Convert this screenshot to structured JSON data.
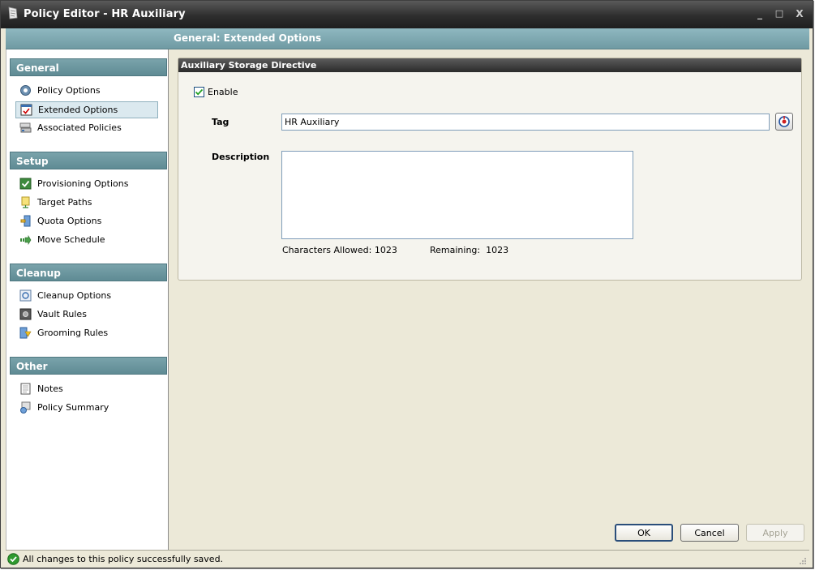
{
  "window": {
    "title": "Policy Editor - HR Auxiliary",
    "minimize": "_",
    "maximize": "□",
    "close": "X"
  },
  "header": {
    "title": "General: Extended Options"
  },
  "sidebar": {
    "sections": [
      {
        "title": "General",
        "items": [
          "Policy Options",
          "Extended Options",
          "Associated Policies"
        ]
      },
      {
        "title": "Setup",
        "items": [
          "Provisioning Options",
          "Target Paths",
          "Quota Options",
          "Move Schedule"
        ]
      },
      {
        "title": "Cleanup",
        "items": [
          "Cleanup Options",
          "Vault Rules",
          "Grooming Rules"
        ]
      },
      {
        "title": "Other",
        "items": [
          "Notes",
          "Policy Summary"
        ]
      }
    ],
    "selected": "Extended Options"
  },
  "main": {
    "group_title": "Auxiliary Storage Directive",
    "enable_label": "Enable",
    "enable_checked": true,
    "tag_label": "Tag",
    "tag_value": "HR Auxiliary",
    "description_label": "Description",
    "description_value": "",
    "chars_allowed": "Characters Allowed: 1023",
    "remaining": "Remaining:  1023"
  },
  "buttons": {
    "ok": "OK",
    "cancel": "Cancel",
    "apply": "Apply"
  },
  "status": {
    "text": "All changes to this policy successfully saved."
  },
  "colors": {
    "section_header": "#6a959e",
    "selected_item": "#dbe9ef",
    "group_header": "#3a3a3a"
  }
}
